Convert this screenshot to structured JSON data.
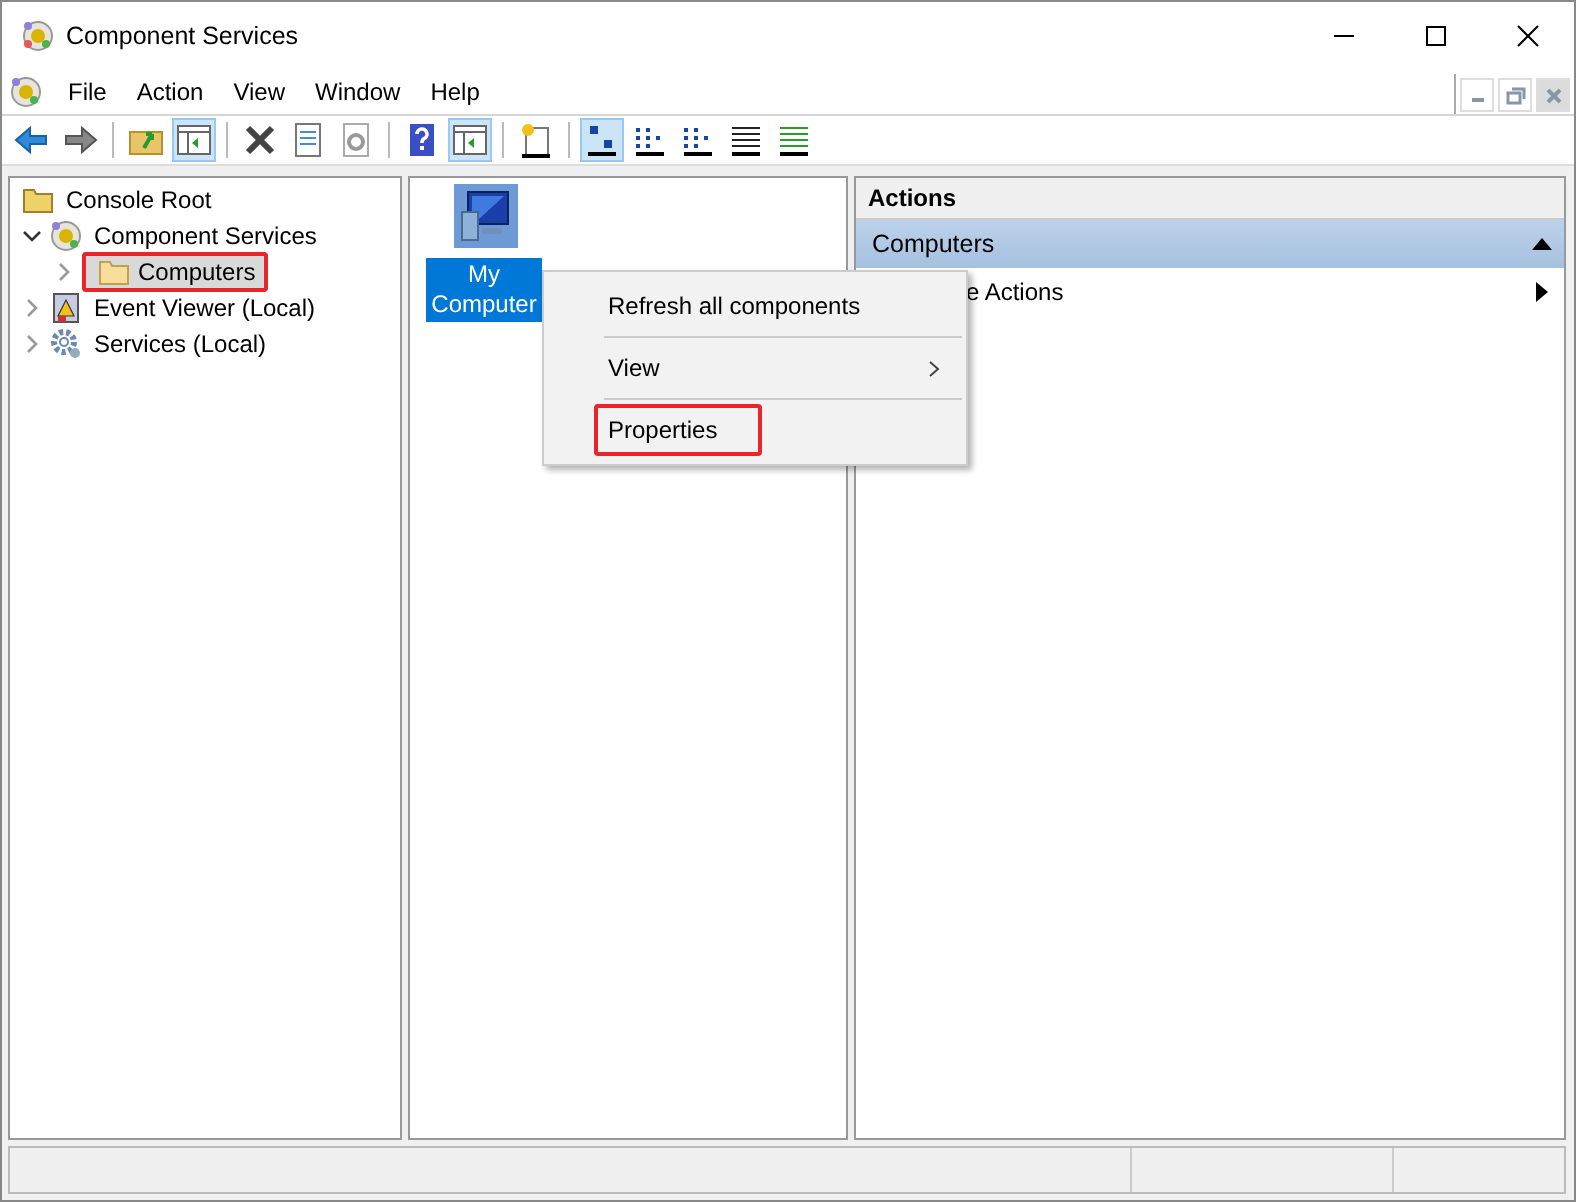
{
  "window": {
    "title": "Component Services"
  },
  "menu": [
    "File",
    "Action",
    "View",
    "Window",
    "Help"
  ],
  "toolbar": [
    {
      "kind": "back",
      "pressed": false
    },
    {
      "kind": "forward",
      "pressed": false
    },
    {
      "kind": "sep"
    },
    {
      "kind": "up",
      "pressed": false
    },
    {
      "kind": "tree",
      "pressed": true
    },
    {
      "kind": "sep"
    },
    {
      "kind": "delete",
      "pressed": false
    },
    {
      "kind": "props",
      "pressed": false
    },
    {
      "kind": "refresh",
      "pressed": false
    },
    {
      "kind": "sep"
    },
    {
      "kind": "help",
      "pressed": false
    },
    {
      "kind": "pane",
      "pressed": true
    },
    {
      "kind": "sep"
    },
    {
      "kind": "newwin",
      "pressed": false
    },
    {
      "kind": "sep"
    },
    {
      "kind": "large",
      "pressed": true
    },
    {
      "kind": "small",
      "pressed": false
    },
    {
      "kind": "list",
      "pressed": false
    },
    {
      "kind": "detail",
      "pressed": false
    },
    {
      "kind": "custom",
      "pressed": false
    }
  ],
  "tree": [
    {
      "label": "Console Root",
      "kind": "folder",
      "children": [
        {
          "label": "Component Services",
          "kind": "com",
          "expanded": true,
          "selected": false,
          "annotated": false,
          "children": [
            {
              "label": "Computers",
              "kind": "folder",
              "expanded": false,
              "selected": true,
              "annotated": true
            }
          ]
        },
        {
          "label": "Event Viewer (Local)",
          "kind": "event",
          "expanded": false,
          "selected": false,
          "annotated": false
        },
        {
          "label": "Services (Local)",
          "kind": "gear",
          "expanded": false,
          "selected": false,
          "annotated": false
        }
      ]
    }
  ],
  "items": [
    {
      "label": "My Computer",
      "selected": true
    }
  ],
  "context_menu": [
    {
      "kind": "item",
      "label": "Refresh all components",
      "submenu": false,
      "annotated": false
    },
    {
      "kind": "sep"
    },
    {
      "kind": "item",
      "label": "View",
      "submenu": true,
      "annotated": false
    },
    {
      "kind": "sep"
    },
    {
      "kind": "item",
      "label": "Properties",
      "submenu": false,
      "annotated": true
    }
  ],
  "actions": {
    "title": "Actions",
    "section": {
      "label": "Computers",
      "expanded": true
    },
    "items": [
      {
        "label": "e Actions",
        "submenu": true
      }
    ]
  }
}
